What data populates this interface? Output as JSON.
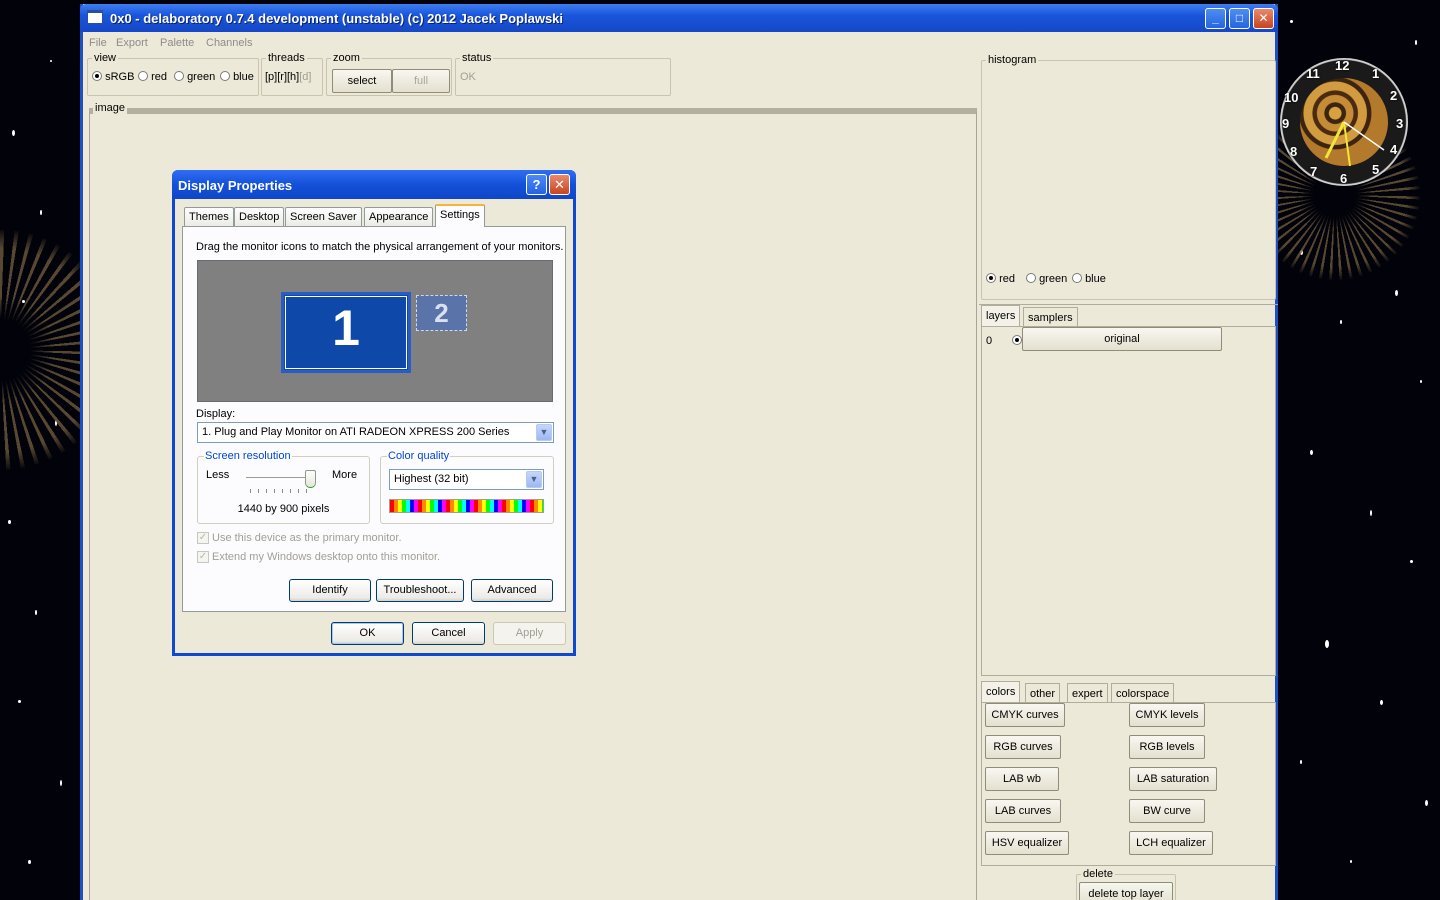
{
  "window": {
    "title": "0x0 - delaboratory 0.7.4 development (unstable) (c) 2012 Jacek Poplawski",
    "controls": [
      "minimize",
      "maximize",
      "close"
    ]
  },
  "menu": [
    "File",
    "Export",
    "Palette",
    "Channels"
  ],
  "view": {
    "label": "view",
    "options": [
      "sRGB",
      "red",
      "green",
      "blue"
    ],
    "selected": "sRGB"
  },
  "threads": {
    "label": "threads",
    "value": "[p][r][h]",
    "dim": "[d]"
  },
  "zoom": {
    "label": "zoom",
    "select": "select",
    "full": "full"
  },
  "status": {
    "label": "status",
    "value": "OK"
  },
  "image": {
    "label": "image"
  },
  "histogram": {
    "label": "histogram",
    "options": [
      "red",
      "green",
      "blue"
    ],
    "selected": "red"
  },
  "layers_tabs": [
    "layers",
    "samplers"
  ],
  "layers": [
    {
      "index": "0",
      "name": "original"
    }
  ],
  "action_tabs": [
    "colors",
    "other",
    "expert",
    "colorspace"
  ],
  "actions": {
    "left": [
      "CMYK curves",
      "RGB curves",
      "LAB wb",
      "LAB curves",
      "HSV equalizer"
    ],
    "right": [
      "CMYK levels",
      "RGB levels",
      "LAB saturation",
      "BW curve",
      "LCH equalizer"
    ]
  },
  "delete": {
    "label": "delete",
    "button": "delete top layer"
  },
  "dialog": {
    "title": "Display Properties",
    "help": "?",
    "tabs": [
      "Themes",
      "Desktop",
      "Screen Saver",
      "Appearance",
      "Settings"
    ],
    "active_tab": "Settings",
    "instruction": "Drag the monitor icons to match the physical arrangement of your monitors.",
    "monitor1": "1",
    "monitor2": "2",
    "display_label": "Display:",
    "display_value": "1. Plug and Play Monitor on ATI RADEON XPRESS 200 Series",
    "resolution": {
      "label": "Screen resolution",
      "less": "Less",
      "more": "More",
      "value": "1440 by 900 pixels"
    },
    "color_quality": {
      "label": "Color quality",
      "value": "Highest (32 bit)"
    },
    "primary_check": "Use this device as the primary monitor.",
    "extend_check": "Extend my Windows desktop onto this monitor.",
    "buttons": {
      "identify": "Identify",
      "troubleshoot": "Troubleshoot...",
      "advanced": "Advanced",
      "ok": "OK",
      "cancel": "Cancel",
      "apply": "Apply"
    }
  },
  "clock": {
    "numbers": [
      "12",
      "1",
      "2",
      "3",
      "4",
      "5",
      "6",
      "7",
      "8",
      "9",
      "10",
      "11"
    ]
  }
}
